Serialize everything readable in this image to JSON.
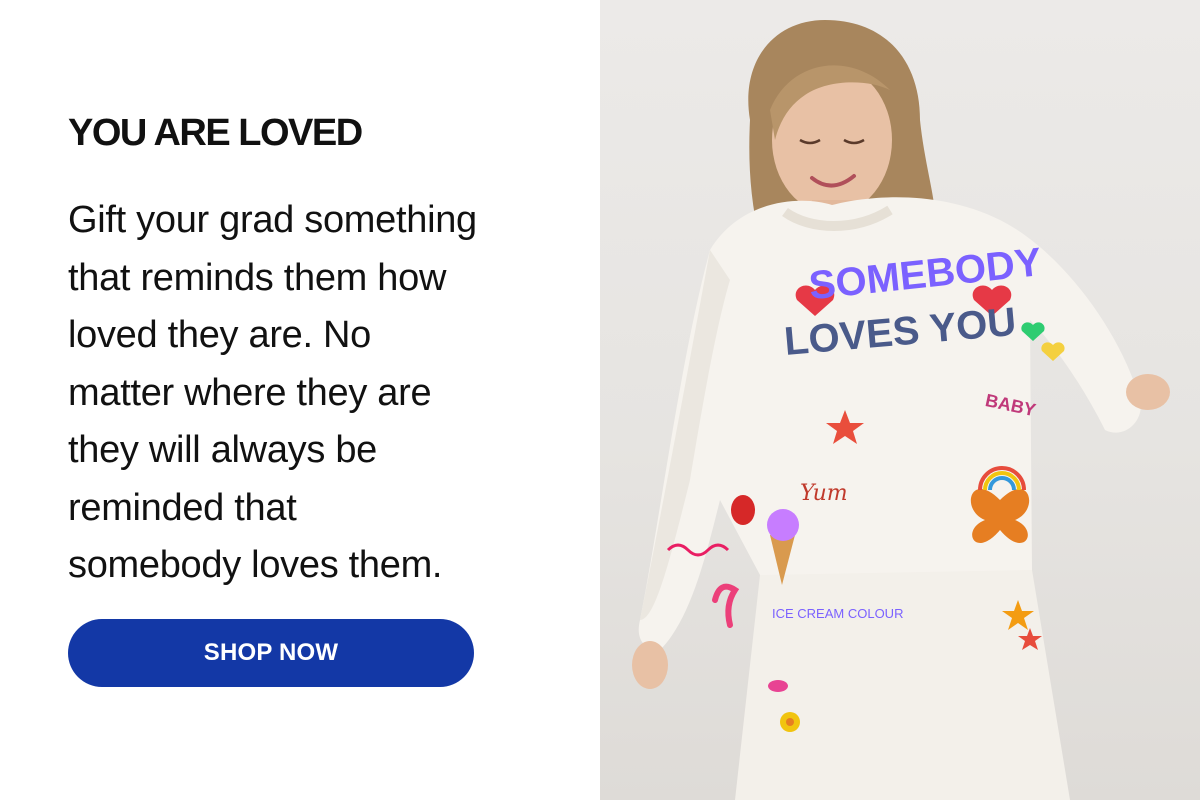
{
  "promo": {
    "title": "YOU ARE LOVED",
    "body_lines": [
      "Gift your grad something",
      "that reminds them how",
      "loved they are. No",
      "matter where they are",
      "they will always be",
      "reminded that",
      "somebody loves them."
    ],
    "cta_label": "SHOP NOW"
  },
  "photo": {
    "sweater_text_line1": "SOMEBODY",
    "sweater_text_line2": "LOVES YOU",
    "doodle_baby": "BABY",
    "doodle_yum": "Yum",
    "pants_text": "ICE CREAM COLOUR"
  },
  "colors": {
    "cta_background": "#1338a6",
    "cta_text": "#ffffff",
    "heading_text": "#111111",
    "photo_background": "#e8e6e3",
    "garment": "#f6f3ee"
  }
}
